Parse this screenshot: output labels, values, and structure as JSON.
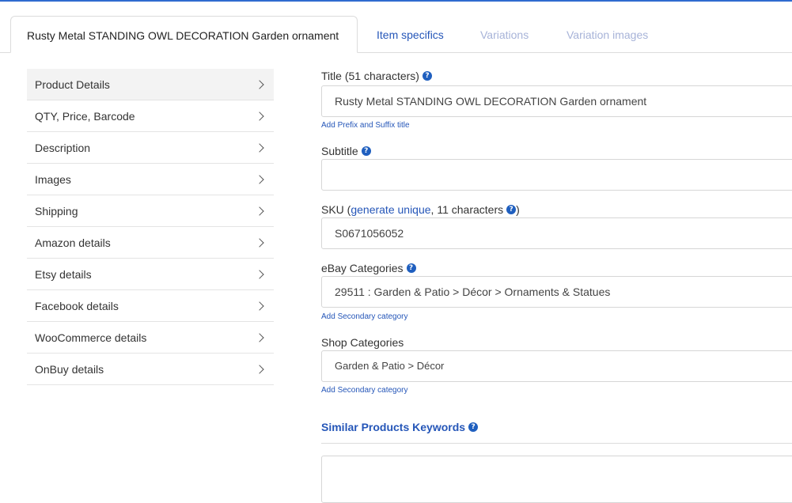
{
  "tabs": [
    {
      "label": "Rusty Metal STANDING OWL DECORATION Garden ornament"
    },
    {
      "label": "Item specifics"
    },
    {
      "label": "Variations"
    },
    {
      "label": "Variation images"
    }
  ],
  "sidebar": {
    "items": [
      {
        "label": "Product Details"
      },
      {
        "label": "QTY, Price, Barcode"
      },
      {
        "label": "Description"
      },
      {
        "label": "Images"
      },
      {
        "label": "Shipping"
      },
      {
        "label": "Amazon details"
      },
      {
        "label": "Etsy details"
      },
      {
        "label": "Facebook details"
      },
      {
        "label": "WooCommerce details"
      },
      {
        "label": "OnBuy details"
      }
    ]
  },
  "form": {
    "title": {
      "label": "Title (51 characters)",
      "value": "Rusty Metal STANDING OWL DECORATION Garden ornament",
      "link": "Add Prefix and Suffix title"
    },
    "subtitle": {
      "label": "Subtitle",
      "value": ""
    },
    "sku": {
      "label_prefix": "SKU (",
      "link": "generate unique",
      "label_suffix": ", 11 characters",
      "label_close": ")",
      "value": "S0671056052"
    },
    "ebay_categories": {
      "label": "eBay Categories",
      "value": "29511 : Garden & Patio > Décor > Ornaments & Statues",
      "link": "Add Secondary category"
    },
    "shop_categories": {
      "label": "Shop Categories",
      "value": "Garden & Patio > Décor",
      "link": "Add Secondary category"
    },
    "similar_keywords": {
      "label": "Similar Products Keywords",
      "value": ""
    }
  },
  "help_icon": "?",
  "colors": {
    "accent": "#2556b8",
    "help": "#1f5fbf",
    "dim_tab": "#a7b3d8"
  }
}
